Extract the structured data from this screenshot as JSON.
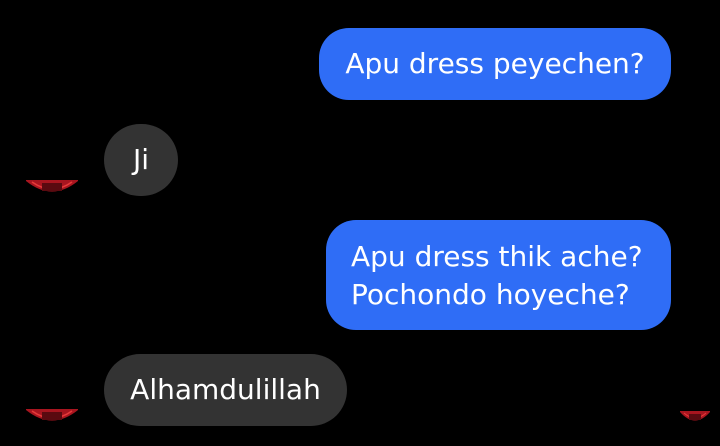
{
  "messages": [
    {
      "direction": "sent",
      "text": "Apu dress peyechen?"
    },
    {
      "direction": "received",
      "text": "Ji"
    },
    {
      "direction": "sent",
      "lines": [
        "Apu dress thik ache?",
        "Pochondo hoyeche?"
      ]
    },
    {
      "direction": "received",
      "text": "Alhamdulillah"
    }
  ],
  "avatar": {
    "icon": "profile-avatar-icon",
    "color": "#a8151f"
  },
  "colors": {
    "background": "#000000",
    "sent_bubble": "#2f6df6",
    "received_bubble": "#333333",
    "text": "#ffffff"
  }
}
